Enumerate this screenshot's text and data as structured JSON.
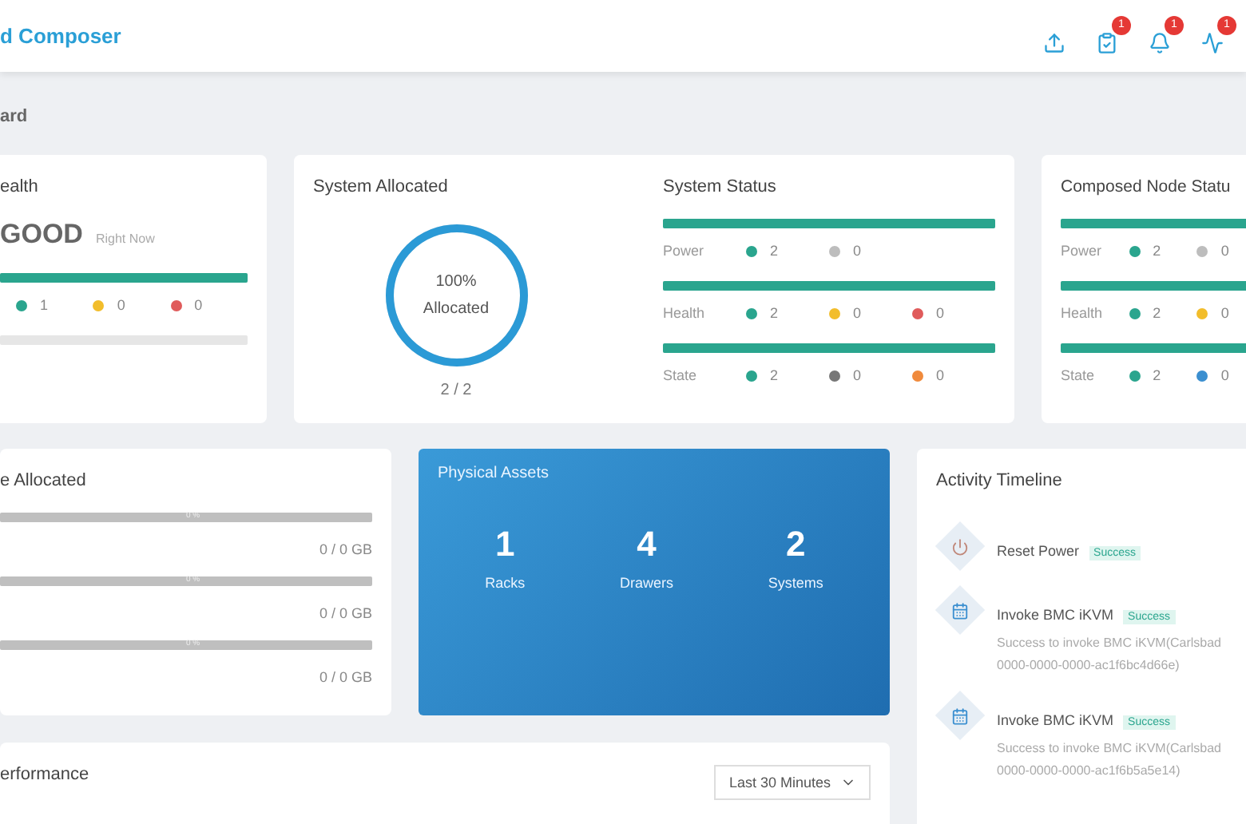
{
  "header": {
    "title": "d Composer",
    "actions": [
      {
        "kind": "upload"
      },
      {
        "kind": "clipboard",
        "badge": "1"
      },
      {
        "kind": "bell",
        "badge": "1"
      },
      {
        "kind": "pulse",
        "badge": "1"
      }
    ]
  },
  "breadcrumb": "ard",
  "health": {
    "title": "ealth",
    "status": "GOOD",
    "time": "Right Now",
    "level": 1,
    "counts": [
      {
        "color": "#2aa58e",
        "value": "1"
      },
      {
        "color": "#f2bd2b",
        "value": "0"
      },
      {
        "color": "#e05b5b",
        "value": "0"
      }
    ]
  },
  "system_allocated": {
    "title": "System Allocated",
    "level": 1,
    "percent": "100%",
    "label": "Allocated",
    "ratio": "2 / 2"
  },
  "system_status": {
    "title": "System Status",
    "rows": [
      {
        "label": "Power",
        "level": 1,
        "counts": [
          {
            "color": "#2aa58e",
            "value": "2"
          },
          {
            "color": "#bdbdbd",
            "value": "0"
          }
        ]
      },
      {
        "label": "Health",
        "level": 1,
        "counts": [
          {
            "color": "#2aa58e",
            "value": "2"
          },
          {
            "color": "#f2bd2b",
            "value": "0"
          },
          {
            "color": "#e05b5b",
            "value": "0"
          }
        ]
      },
      {
        "label": "State",
        "level": 1,
        "counts": [
          {
            "color": "#2aa58e",
            "value": "2"
          },
          {
            "color": "#777777",
            "value": "0"
          },
          {
            "color": "#f08a3c",
            "value": "0"
          }
        ]
      }
    ]
  },
  "composed_node_status": {
    "title": "Composed Node Statu",
    "rows": [
      {
        "label": "Power",
        "level": 1,
        "counts": [
          {
            "color": "#2aa58e",
            "value": "2"
          },
          {
            "color": "#bdbdbd",
            "value": "0"
          }
        ]
      },
      {
        "label": "Health",
        "level": 1,
        "counts": [
          {
            "color": "#2aa58e",
            "value": "2"
          },
          {
            "color": "#f2bd2b",
            "value": "0"
          }
        ]
      },
      {
        "label": "State",
        "level": 1,
        "counts": [
          {
            "color": "#2aa58e",
            "value": "2"
          },
          {
            "color": "#3b8fd0",
            "value": "0"
          }
        ]
      }
    ]
  },
  "resource_allocated": {
    "title": "e Allocated",
    "rows": [
      {
        "percent": "0 %",
        "level": 0,
        "amount": "0 / 0 GB"
      },
      {
        "percent": "0 %",
        "level": 0,
        "amount": "0 / 0 GB"
      },
      {
        "percent": "0 %",
        "level": 0,
        "amount": "0 / 0 GB"
      }
    ]
  },
  "physical_assets": {
    "title": "Physical Assets",
    "items": [
      {
        "value": "1",
        "label": "Racks"
      },
      {
        "value": "4",
        "label": "Drawers"
      },
      {
        "value": "2",
        "label": "Systems"
      }
    ]
  },
  "activity_timeline": {
    "title": "Activity Timeline",
    "items": [
      {
        "kind": "power",
        "title": "Reset Power",
        "status": "Success"
      },
      {
        "kind": "calendar",
        "title": "Invoke BMC iKVM",
        "status": "Success",
        "lines": [
          "Success to invoke BMC iKVM(Carlsbad",
          "0000-0000-0000-ac1f6bc4d66e)"
        ]
      },
      {
        "kind": "calendar",
        "title": "Invoke BMC iKVM",
        "status": "Success",
        "lines": [
          "Success to invoke BMC iKVM(Carlsbad",
          "0000-0000-0000-ac1f6b5a5e14)"
        ]
      }
    ]
  },
  "performance": {
    "title": "erformance",
    "range": "Last 30 Minutes"
  }
}
